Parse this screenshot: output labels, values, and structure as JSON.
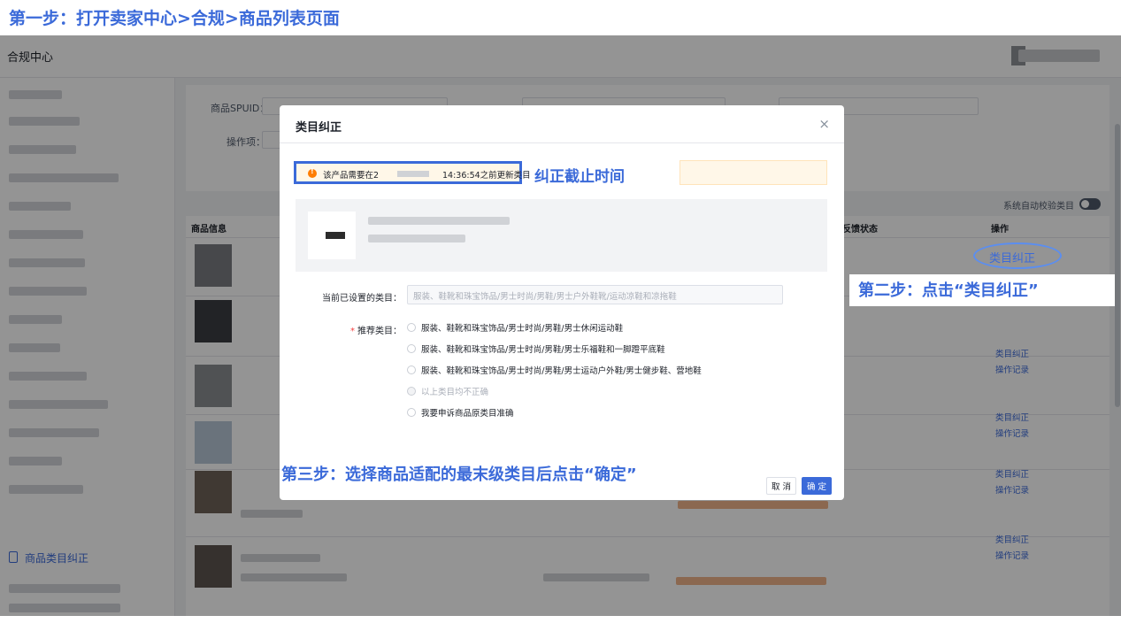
{
  "annotations": {
    "step1": "第一步：打开卖家中心>合规>商品列表页面",
    "step2": "第二步：点击“类目纠正”",
    "step3": "第三步：选择商品适配的最末级类目后点击“确定”",
    "deadline": "纠正截止时间"
  },
  "header": {
    "title": "合规中心"
  },
  "sidebar": {
    "active_item": "商品类目纠正"
  },
  "filters": {
    "spuid_label": "商品SPUID：",
    "operation_label": "操作项："
  },
  "toolbar": {
    "auto_check_label": "系统自动校验类目"
  },
  "table": {
    "col_product": "商品信息",
    "col_feedback": "目反馈状态",
    "col_action": "操作",
    "highlight_action": "类目纠正",
    "rows": [
      {
        "action1": "类目纠正",
        "action2": "操作记录"
      },
      {
        "action1": "类目纠正",
        "action2": "操作记录"
      },
      {
        "action1": "类目纠正",
        "action2": "操作记录"
      },
      {
        "action1": "类目纠正",
        "action2": "操作记录"
      }
    ]
  },
  "modal": {
    "title": "类目纠正",
    "close": "×",
    "notice_prefix": "该产品需要在2",
    "notice_time": "14:36:54之前更新类目",
    "current_label": "当前已设置的类目：",
    "current_value": "服装、鞋靴和珠宝饰品/男士时尚/男鞋/男士户外鞋靴/运动凉鞋和凉拖鞋",
    "recommend_star": "*",
    "recommend_label": "推荐类目：",
    "options": [
      "服装、鞋靴和珠宝饰品/男士时尚/男鞋/男士休闲运动鞋",
      "服装、鞋靴和珠宝饰品/男士时尚/男鞋/男士乐福鞋和一脚蹬平底鞋",
      "服装、鞋靴和珠宝饰品/男士时尚/男鞋/男士运动户外鞋/男士健步鞋、营地鞋",
      "以上类目均不正确",
      "我要申诉商品原类目准确"
    ],
    "cancel": "取 消",
    "ok": "确 定"
  },
  "colors": {
    "accent": "#3b6ad9",
    "warning": "#ff7d00"
  }
}
